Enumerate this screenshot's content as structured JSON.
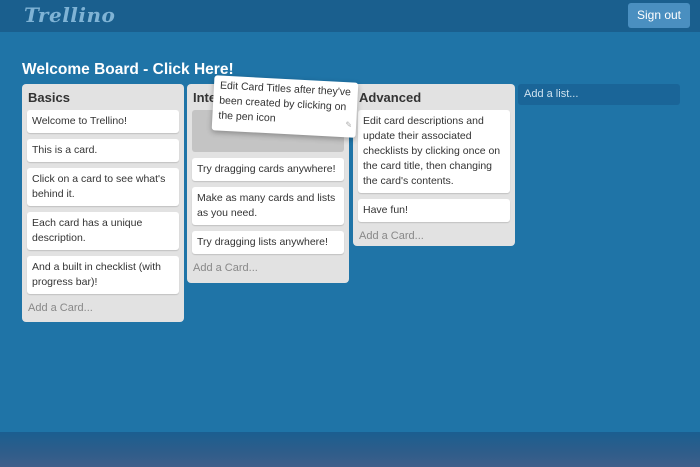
{
  "app": {
    "logo": "Trellino",
    "signout_label": "Sign out"
  },
  "board": {
    "title": "Welcome Board - Click Here!"
  },
  "lists": [
    {
      "title": "Basics",
      "cards": [
        "Welcome to Trellino!",
        "This is a card.",
        "Click on a card to see what's behind it.",
        "Each card has a unique description.",
        "And a built in checklist (with progress bar)!"
      ],
      "add_card": "Add a Card..."
    },
    {
      "title": "Inter",
      "cards": [
        "Try dragging cards anywhere!",
        "Make as many cards and lists as you need.",
        "Try dragging lists anywhere!"
      ],
      "add_card": "Add a Card..."
    },
    {
      "title": "Advanced",
      "cards": [
        "Edit card descriptions and update their associated checklists by clicking once on the card title, then changing the card's contents.",
        "Have fun!"
      ],
      "add_card": "Add a Card..."
    }
  ],
  "dragging_card": {
    "text": "Edit Card Titles after they've been created by clicking on the pen icon"
  },
  "add_list": {
    "label": "Add a list..."
  }
}
